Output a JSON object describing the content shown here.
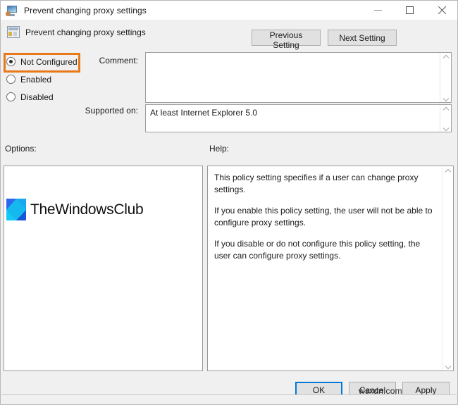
{
  "window": {
    "title": "Prevent changing proxy settings",
    "icon": "monitor-icon",
    "controls": {
      "minimize": "–",
      "maximize": "□",
      "close": "✕"
    }
  },
  "header": {
    "policy_name": "Prevent changing proxy settings",
    "icon": "policy-setting-icon",
    "previous_button": "Previous Setting",
    "next_button": "Next Setting"
  },
  "state_options": {
    "selected": "Not Configured",
    "highlight_color": "#e8791a",
    "items": [
      {
        "label": "Not Configured",
        "checked": true
      },
      {
        "label": "Enabled",
        "checked": false
      },
      {
        "label": "Disabled",
        "checked": false
      }
    ]
  },
  "fields": {
    "comment_label": "Comment:",
    "comment_value": "",
    "supported_label": "Supported on:",
    "supported_value": "At least Internet Explorer 5.0"
  },
  "sections": {
    "options_label": "Options:",
    "help_label": "Help:"
  },
  "help": {
    "paragraph1": "This policy setting specifies if a user can change proxy settings.",
    "paragraph2": "If you enable this policy setting, the user will not be able to configure proxy settings.",
    "paragraph3": "If you disable or do not configure this policy setting, the user can configure proxy settings."
  },
  "watermark": {
    "brand": "TheWindowsClub",
    "logo_colors": [
      "#2f66f0",
      "#1aa7f0",
      "#16c8f5",
      "#1557d8"
    ],
    "site_credit": "wsxdn.com"
  },
  "footer": {
    "ok": "OK",
    "cancel": "Cancel",
    "apply": "Apply",
    "focus_color": "#0078d7"
  }
}
